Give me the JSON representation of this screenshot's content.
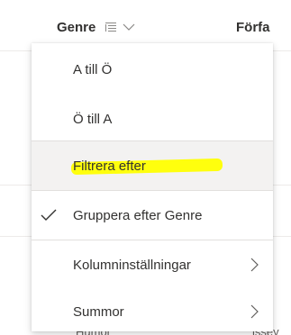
{
  "header": {
    "genre_label": "Genre",
    "author_label": "Förfa"
  },
  "menu": {
    "items": [
      {
        "label": "A till Ö",
        "checked": false,
        "submenu": false
      },
      {
        "label": "Ö till A",
        "checked": false,
        "submenu": false
      },
      {
        "label": "Filtrera efter",
        "checked": false,
        "submenu": false,
        "hovered": true,
        "annotation": "yellow-highlight"
      },
      {
        "label": "Gruppera efter Genre",
        "checked": true,
        "submenu": false
      },
      {
        "label": "Kolumninställningar",
        "checked": false,
        "submenu": true
      },
      {
        "label": "Summor",
        "checked": false,
        "submenu": true
      }
    ]
  },
  "background": {
    "row_left_text": "Humor",
    "row_right_text": "issey"
  },
  "colors": {
    "hover_background": "#f3f2f1",
    "highlight": "#ffff00",
    "text": "#323130",
    "separator": "#e1dfdd"
  }
}
